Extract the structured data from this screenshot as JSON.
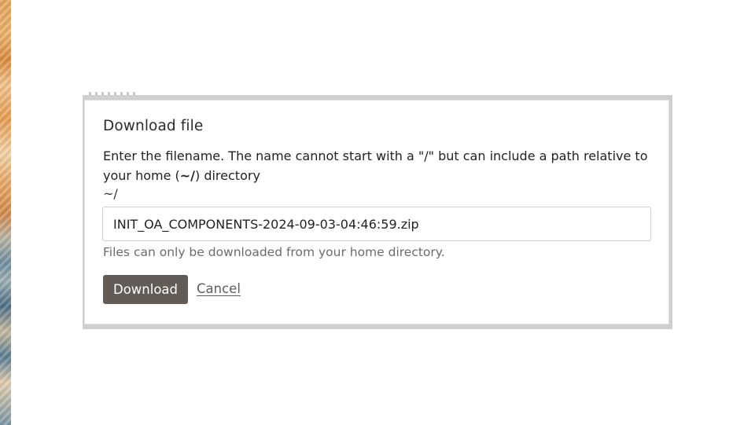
{
  "dialog": {
    "title": "Download file",
    "instructions_part1": "Enter the filename. The name cannot start with a \"/\" but can include a path relative to your home (",
    "instructions_code": "~/",
    "instructions_part2": ") directory",
    "home_path": "~/",
    "filename_value": "INIT_OA_COMPONENTS-2024-09-03-04:46:59.zip",
    "help_text": "Files can only be downloaded from your home directory.",
    "download_label": "Download",
    "cancel_label": "Cancel"
  },
  "colors": {
    "primary_button": "#615c57",
    "help_text": "#6b6b6b"
  }
}
